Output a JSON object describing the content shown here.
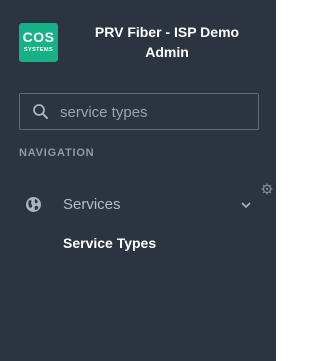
{
  "header": {
    "logo_main": "COS",
    "logo_sub": "SYSTEMS",
    "title": "PRV Fiber - ISP Demo Admin"
  },
  "search": {
    "value": "service types",
    "icon": "search-icon"
  },
  "navigation": {
    "heading": "NAVIGATION",
    "settings_icon": "gear-icon",
    "items": [
      {
        "label": "Services",
        "icon": "globe-icon",
        "expanded": true,
        "children": [
          {
            "label": "Service Types"
          }
        ]
      }
    ]
  },
  "colors": {
    "sidebar_bg": "#2b3440",
    "logo_bg": "#16b187",
    "heading_text": "#8f9aa5",
    "item_text": "#b5bdc5",
    "active_text": "#ffffff"
  }
}
